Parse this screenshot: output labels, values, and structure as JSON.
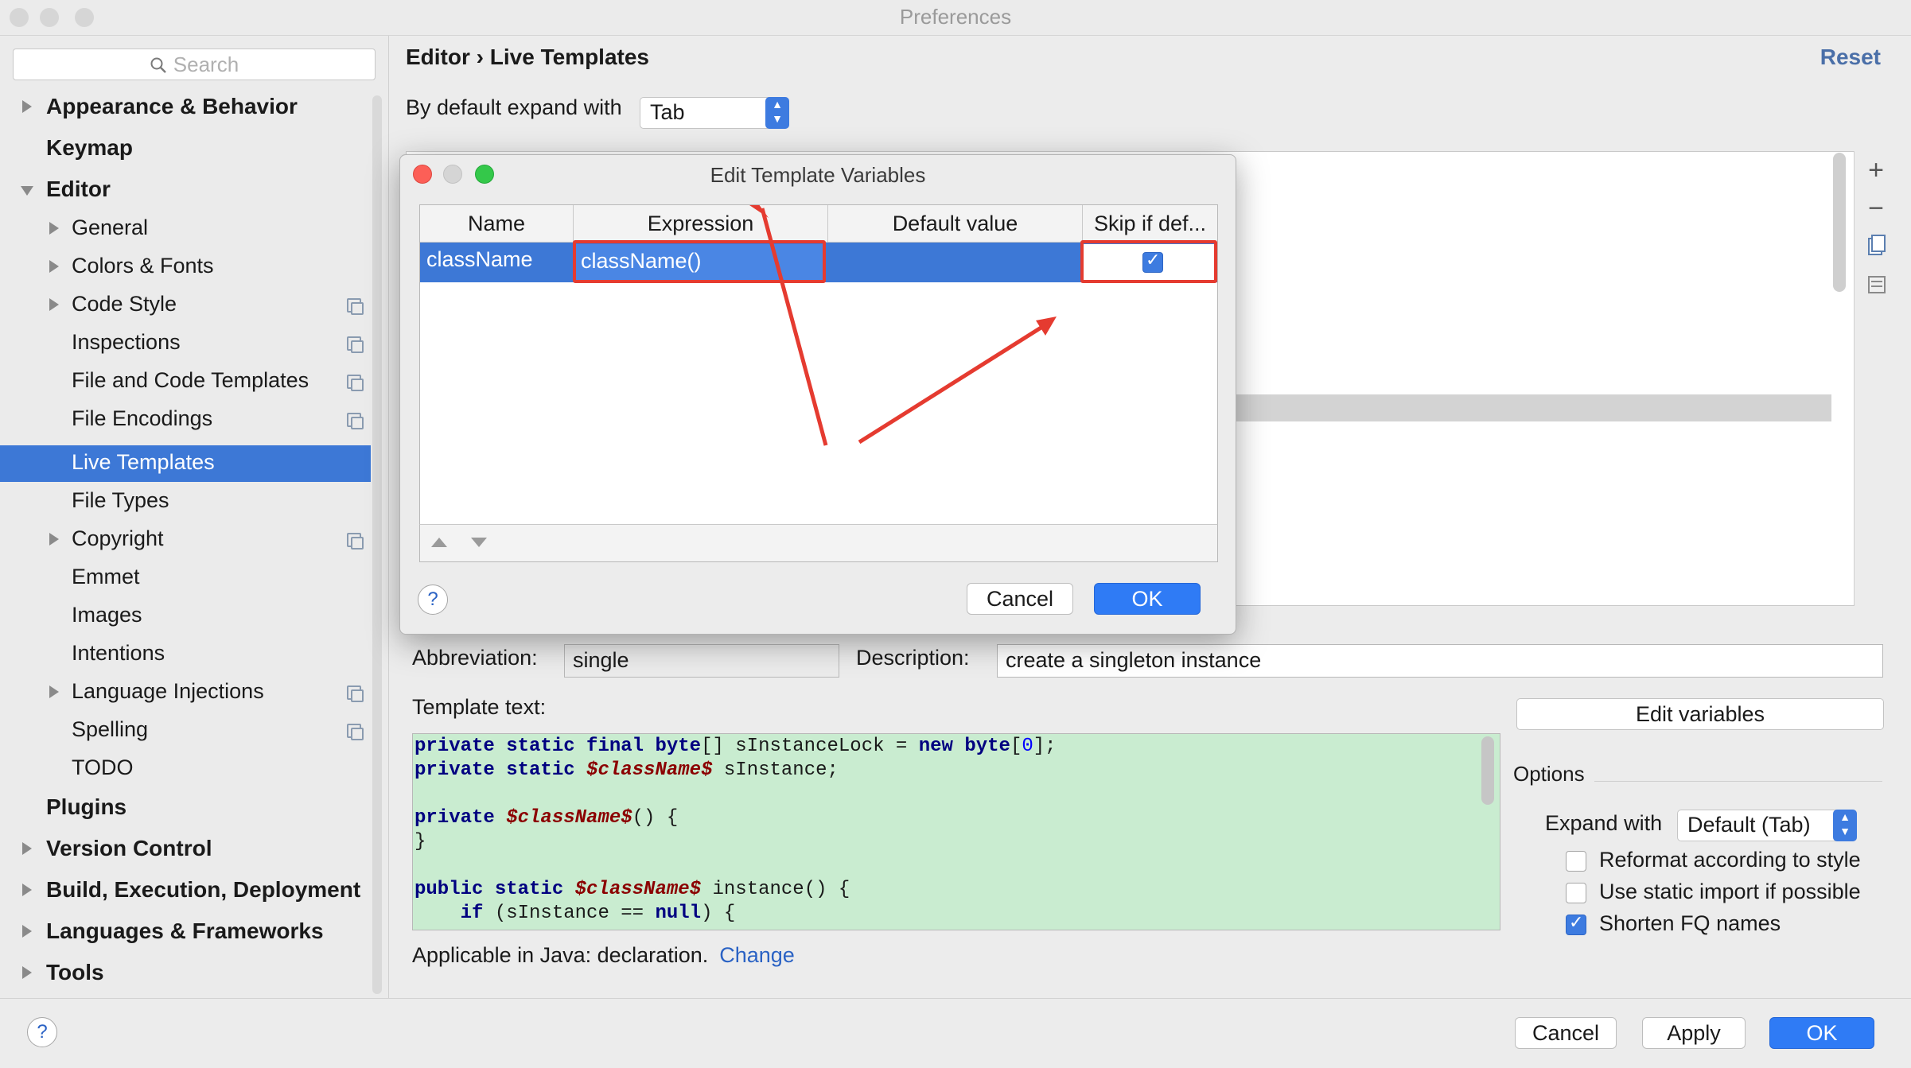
{
  "window": {
    "title": "Preferences"
  },
  "search": {
    "placeholder": "Search"
  },
  "sidebar": {
    "items": [
      {
        "label": "Appearance & Behavior"
      },
      {
        "label": "Keymap"
      },
      {
        "label": "Editor"
      },
      {
        "label": "General"
      },
      {
        "label": "Colors & Fonts"
      },
      {
        "label": "Code Style"
      },
      {
        "label": "Inspections"
      },
      {
        "label": "File and Code Templates"
      },
      {
        "label": "File Encodings"
      },
      {
        "label": "Live Templates"
      },
      {
        "label": "File Types"
      },
      {
        "label": "Copyright"
      },
      {
        "label": "Emmet"
      },
      {
        "label": "Images"
      },
      {
        "label": "Intentions"
      },
      {
        "label": "Language Injections"
      },
      {
        "label": "Spelling"
      },
      {
        "label": "TODO"
      },
      {
        "label": "Plugins"
      },
      {
        "label": "Version Control"
      },
      {
        "label": "Build, Execution, Deployment"
      },
      {
        "label": "Languages & Frameworks"
      },
      {
        "label": "Tools"
      }
    ]
  },
  "main": {
    "breadcrumb": "Editor › Live Templates",
    "reset": "Reset",
    "expand_label": "By default expand with",
    "expand_value": "Tab",
    "abbreviation_label": "Abbreviation:",
    "abbreviation_value": "single",
    "description_label": "Description:",
    "description_value": "create a singleton instance",
    "template_text_label": "Template text:",
    "applicable_text": "Applicable in Java: declaration.",
    "change_link": "Change",
    "edit_variables": "Edit variables",
    "options_label": "Options",
    "expand_with_label": "Expand with",
    "expand_with_value": "Default (Tab)",
    "checkboxes": [
      {
        "label": "Reformat according to style",
        "checked": false
      },
      {
        "label": "Use static import if possible",
        "checked": false
      },
      {
        "label": "Shorten FQ names",
        "checked": true
      }
    ]
  },
  "code": {
    "l1a": "private static final byte",
    "l1b": "[] sInstanceLock = ",
    "l1c": "new byte",
    "l1d": "[",
    "l1e": "0",
    "l1f": "];",
    "l2a": "private static ",
    "l2b": "$className$",
    "l2c": " sInstance;",
    "l4a": "private ",
    "l4b": "$className$",
    "l4c": "() {",
    "l5": "}",
    "l7a": "public static ",
    "l7b": "$className$",
    "l7c": " instance() {",
    "l8a": "    if",
    "l8b": " (sInstance == ",
    "l8c": "null",
    "l8d": ") {"
  },
  "dialog": {
    "title": "Edit Template Variables",
    "columns": [
      "Name",
      "Expression",
      "Default value",
      "Skip if def..."
    ],
    "row": {
      "name": "className",
      "expression": "className()",
      "default_value": "",
      "skip": true
    },
    "cancel": "Cancel",
    "ok": "OK",
    "help": "?"
  },
  "bottom": {
    "help": "?",
    "cancel": "Cancel",
    "apply": "Apply",
    "ok": "OK"
  },
  "colors": {
    "selection": "#3d78d6",
    "primary_button": "#2f7bf5",
    "annotation": "#e53b30",
    "template_bg": "#c9ecd0"
  }
}
